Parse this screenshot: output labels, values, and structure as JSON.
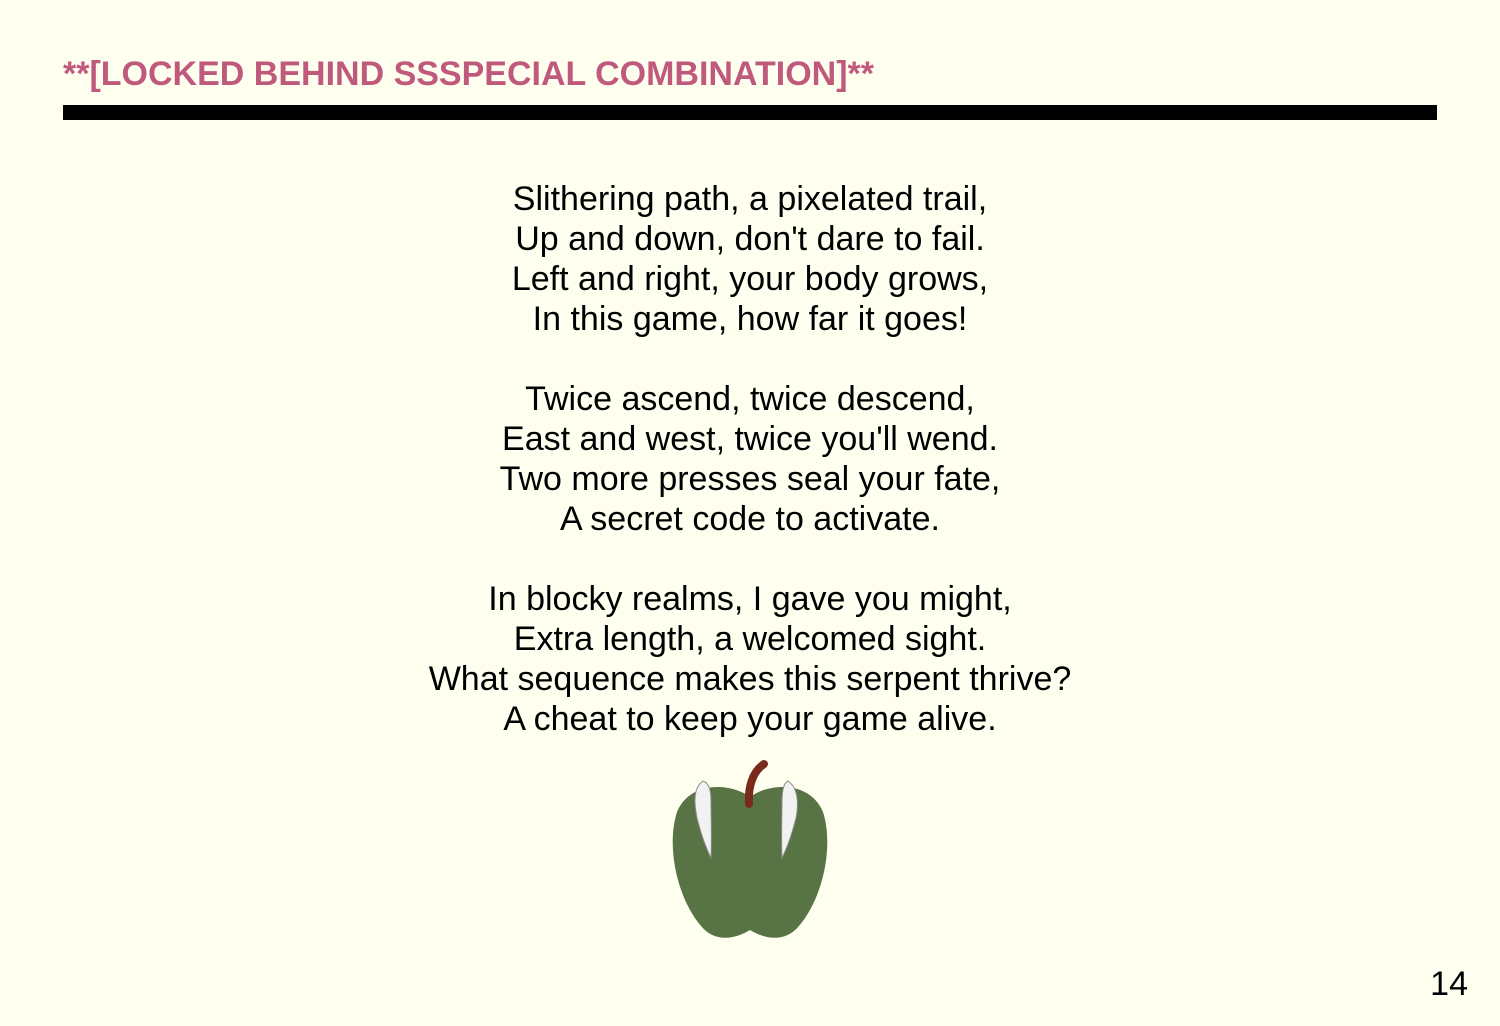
{
  "heading": "**[LOCKED BEHIND SSSPECIAL COMBINATION]**",
  "poem": {
    "stanzas": [
      [
        "Slithering path, a pixelated trail,",
        "Up and down, don't dare to fail.",
        "Left and right, your body grows,",
        "In this game, how far it goes!"
      ],
      [
        "Twice ascend, twice descend,",
        "East and west, twice you'll wend.",
        "Two more presses seal your fate,",
        "A secret code to activate."
      ],
      [
        "In blocky realms, I gave you might,",
        "Extra length, a welcomed sight.",
        "What sequence makes this serpent thrive?",
        "A cheat to keep your game alive."
      ]
    ]
  },
  "illustration": {
    "icon": "fanged-green-apple-icon",
    "colors": {
      "apple": "#587445",
      "stem": "#7a2a1c",
      "fangs": "#f2f2f2"
    }
  },
  "page_number": "14",
  "colors": {
    "heading": "#c05a7d",
    "background": "#fffff0",
    "rule": "#000000"
  }
}
